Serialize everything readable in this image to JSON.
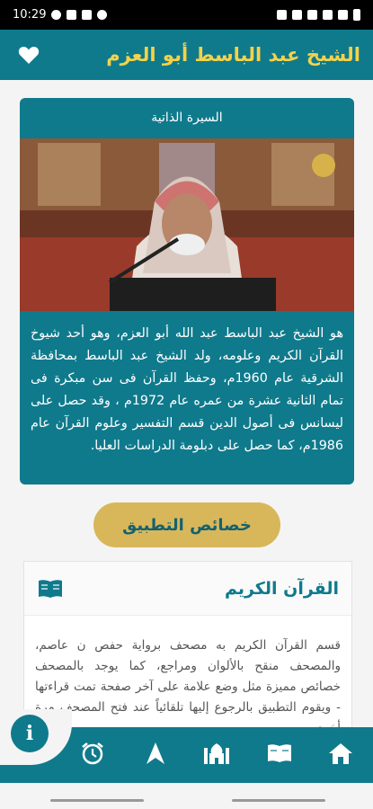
{
  "status": {
    "time": "10:29"
  },
  "app": {
    "title": "الشيخ عبد الباسط أبو العزم",
    "favorite_icon": "heart-icon"
  },
  "bio": {
    "header": "السيرة الذاتية",
    "text": "هو الشيخ عبد الباسط عبد الله أبو العزم، وهو أحد شيوخ القرآن الكريم وعلومه، ولد الشيخ عبد الباسط بمحافظة الشرقية عام 1960م، وحفظ القرآن فى سن مبكرة فى تمام الثانية عشرة من عمره عام 1972م ، وقد حصل على ليسانس فى أصول الدين قسم التفسير وعلوم القرآن عام 1986م، كما حصل على دبلومة الدراسات العليا."
  },
  "features_button": "خصائص التطبيق",
  "quran_card": {
    "title": "القرآن الكريم",
    "icon": "book-icon",
    "text": "قسم القرآن الكريم به مصحف برواية حفص ن عاصم، والمصحف منقح بالألوان ومراجع، كما يوجد بالمصحف خصائص مميزة مثل وضع علامة على آخر صفحة تمت قراءتها - ويقوم التطبيق بالرجوع إليها تلقائياً عند فتح المصحف مرة أخرى"
  },
  "bottom_nav": {
    "items": [
      "home-icon",
      "quran-icon",
      "mosque-icon",
      "qibla-icon",
      "alarm-icon"
    ],
    "info": "i"
  },
  "colors": {
    "primary": "#0f7a8c",
    "accent": "#f4d24a",
    "gold": "#d8b75a"
  }
}
